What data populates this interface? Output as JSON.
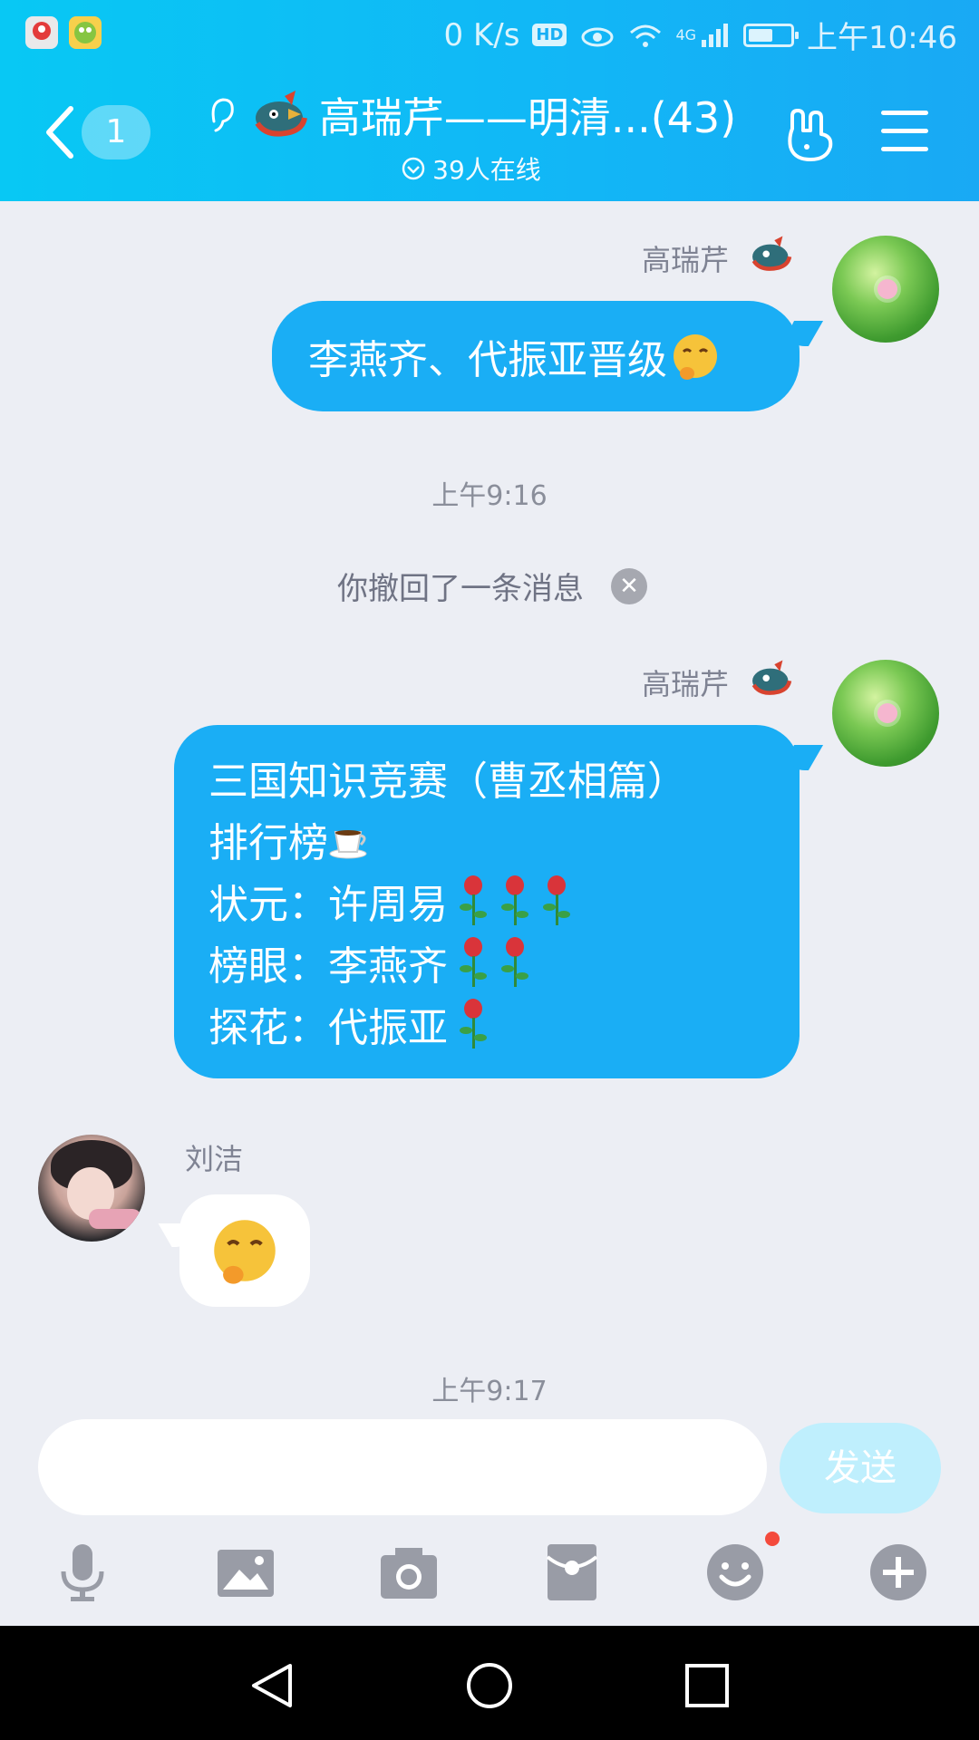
{
  "status_bar": {
    "network_speed": "0 K/s",
    "hd_label": "HD",
    "signal_label": "4G",
    "time": "上午10:46",
    "battery_level": 0.6
  },
  "header": {
    "unread_count": "1",
    "title": "高瑞芹——明清...(43)",
    "online": "39人在线"
  },
  "messages": [
    {
      "sender": "高瑞芹",
      "text": "李燕齐、代振亚晋级"
    },
    {
      "time": "上午9:16"
    },
    {
      "recall": "你撤回了一条消息"
    },
    {
      "sender": "高瑞芹",
      "lines": [
        "三国知识竞赛（曹丞相篇）",
        "排行榜",
        "状元：许周易",
        "榜眼：李燕齐",
        "探花：代振亚"
      ]
    },
    {
      "sender": "刘洁"
    },
    {
      "time": "上午9:17"
    }
  ],
  "input": {
    "placeholder": "",
    "send_label": "发送"
  },
  "icons": {
    "back": "back-chevron-icon",
    "ear": "ear-icon",
    "group_emblem": "dragon-emblem-icon",
    "group_hand": "rock-hand-icon",
    "menu": "hamburger-menu-icon",
    "tools": [
      "microphone-icon",
      "image-icon",
      "camera-icon",
      "red-envelope-icon",
      "emoji-icon",
      "plus-icon"
    ],
    "nav": [
      "back-triangle-icon",
      "home-circle-icon",
      "recent-square-icon"
    ]
  },
  "colors": {
    "accent": "#1aaef5",
    "header_start": "#08c8f4",
    "background": "#eceef4",
    "send_disabled": "#bfeffd"
  }
}
